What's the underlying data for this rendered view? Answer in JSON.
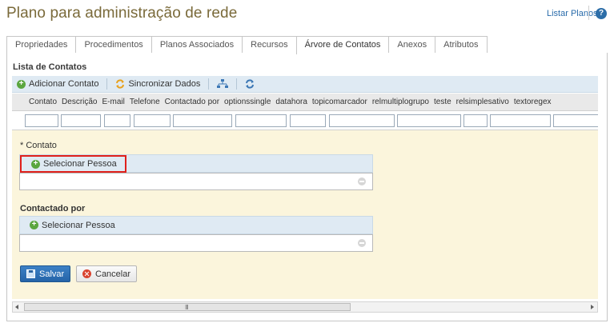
{
  "header": {
    "title": "Plano para administração de rede",
    "list_link": "Listar Planos",
    "help_icon": "help-icon"
  },
  "tabs": [
    {
      "label": "Propriedades",
      "active": false
    },
    {
      "label": "Procedimentos",
      "active": false
    },
    {
      "label": "Planos Associados",
      "active": false
    },
    {
      "label": "Recursos",
      "active": false
    },
    {
      "label": "Árvore de Contatos",
      "active": true
    },
    {
      "label": "Anexos",
      "active": false
    },
    {
      "label": "Atributos",
      "active": false
    }
  ],
  "panel": {
    "title": "Lista de Contatos",
    "toolbar": {
      "add_label": "Adicionar Contato",
      "sync_label": "Sincronizar Dados",
      "icons": [
        "add-icon",
        "sync-icon",
        "tree-icon",
        "refresh-icon"
      ]
    },
    "grid": {
      "columns": [
        "Contato",
        "Descrição",
        "E-mail",
        "Telefone",
        "Contactado por",
        "optionssingle",
        "datahora",
        "topicomarcador",
        "relmultiplogrupo",
        "teste",
        "relsimplesativo",
        "textoregex"
      ]
    }
  },
  "form": {
    "contato_label": "* Contato",
    "contato_select": "Selecionar Pessoa",
    "contactado_label": "Contactado por",
    "contactado_select": "Selecionar Pessoa",
    "save_label": "Salvar",
    "cancel_label": "Cancelar"
  },
  "colors": {
    "accent": "#2564a8",
    "title": "#7a6a3a",
    "form_bg": "#fbf5dc",
    "highlight": "#e0201b"
  }
}
